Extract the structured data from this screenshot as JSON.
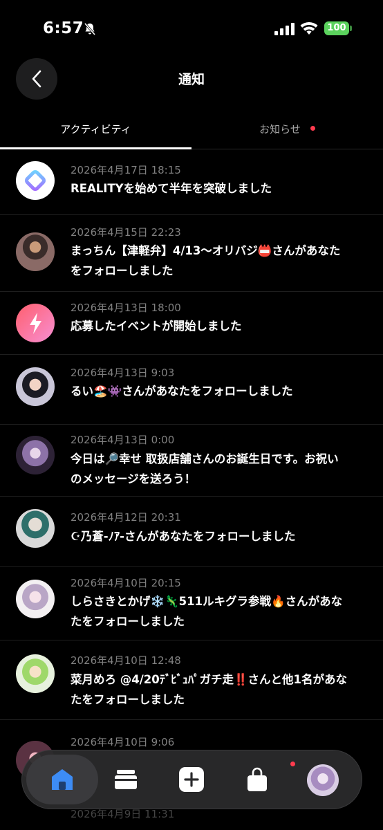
{
  "status_bar": {
    "time": "6:57",
    "battery": "100"
  },
  "header": {
    "title": "通知"
  },
  "tabs": [
    {
      "label": "アクティビティ",
      "active": true
    },
    {
      "label": "お知らせ",
      "active": false,
      "has_badge": true
    }
  ],
  "notifications": [
    {
      "date": "2026年4月17日 18:15",
      "text": "REALITYを始めて半年を突破しました",
      "avatar": "reality-app-icon"
    },
    {
      "date": "2026年4月15日 22:23",
      "text": "まっちん【津軽弁】4/13〜オリバジ📛さんがあなたをフォローしました",
      "avatar": "user-avatar"
    },
    {
      "date": "2026年4月13日 18:00",
      "text": "応募したイベントが開始しました",
      "avatar": "lightning-event-icon"
    },
    {
      "date": "2026年4月13日 9:03",
      "text": "るい🏖️👾さんがあなたをフォローしました",
      "avatar": "user-avatar"
    },
    {
      "date": "2026年4月13日 0:00",
      "text": "今日は🔎幸せ 取扱店舗さんのお誕生日です。お祝いのメッセージを送ろう！",
      "avatar": "user-avatar"
    },
    {
      "date": "2026年4月12日 20:31",
      "text": "☪乃蒼-ﾉｱ-さんがあなたをフォローしました",
      "avatar": "user-avatar"
    },
    {
      "date": "2026年4月10日 20:15",
      "text": "しらさきとかげ❄️🦎511ルキグラ参戦🔥さんがあなたをフォローしました",
      "avatar": "user-avatar"
    },
    {
      "date": "2026年4月10日 12:48",
      "text": "菜月めろ @4/20ﾃﾞﾋﾞｭﾊﾟガチ走‼️さんと他1名があなたをフォローしました",
      "avatar": "user-avatar"
    },
    {
      "date": "2026年4月10日 9:06",
      "text": "",
      "avatar": "user-avatar"
    }
  ],
  "trailing_date": "2026年4月9日 11:31",
  "tab_bar": {
    "items": [
      "home",
      "wallet",
      "create",
      "shop",
      "profile"
    ],
    "shop_badge": true
  },
  "colors": {
    "accent": "#3d8cf5",
    "badge": "#ff3b4e",
    "battery": "#5bd25d"
  }
}
